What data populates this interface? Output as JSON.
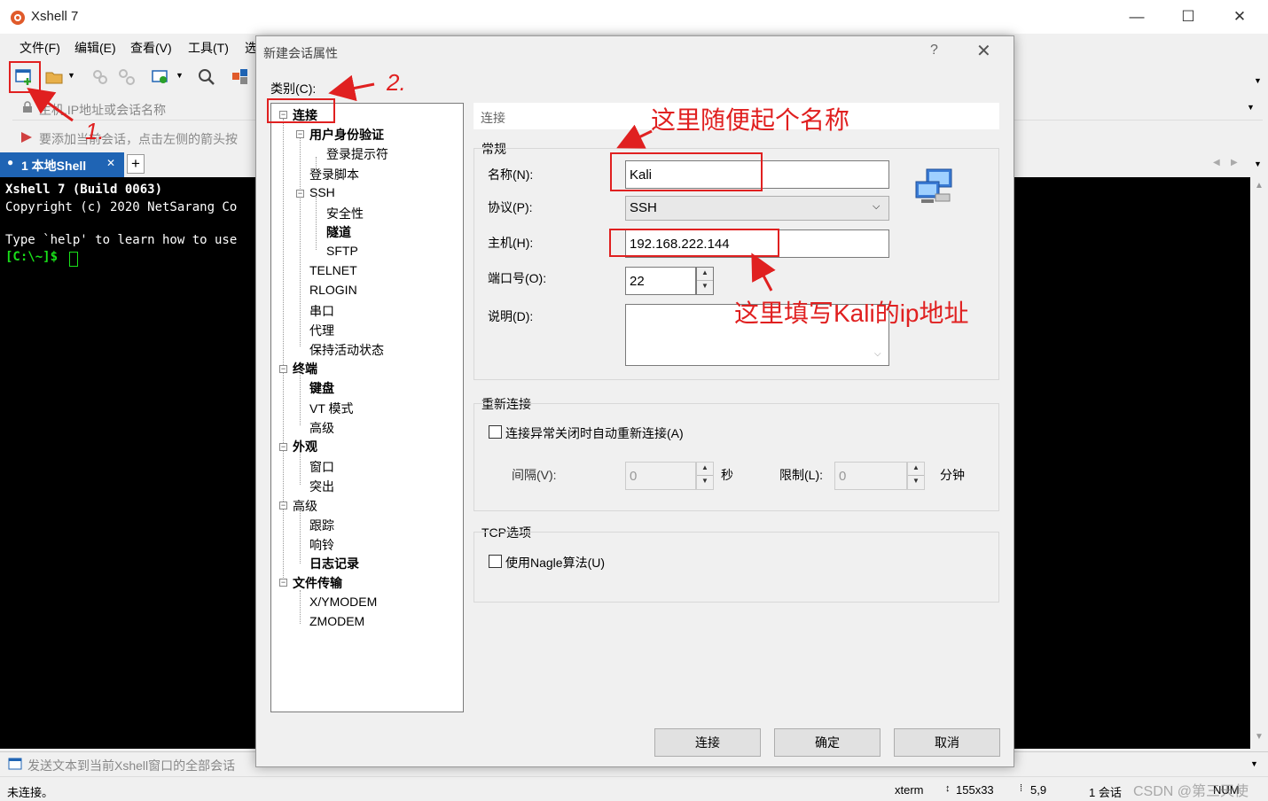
{
  "app": {
    "title": "Xshell 7",
    "window_controls": {
      "minimize": "—",
      "maximize": "☐",
      "close": "✕"
    }
  },
  "menu": [
    "文件(F)",
    "编辑(E)",
    "查看(V)",
    "工具(T)",
    "选"
  ],
  "address": {
    "placeholder": "主机,IP地址或会话名称"
  },
  "hint": {
    "text": "要添加当前会话，点击左侧的箭头按"
  },
  "tabs": {
    "active_label": "1 本地Shell",
    "close": "✕",
    "add": "+"
  },
  "terminal": {
    "lines": [
      "Xshell 7 (Build 0063)",
      "Copyright (c) 2020 NetSarang Co",
      "",
      "Type `help' to learn how to use"
    ],
    "prompt": "[C:\\~]$ "
  },
  "sendbar": {
    "text": "发送文本到当前Xshell窗口的全部会话"
  },
  "status": {
    "left": "未连接。",
    "term": "xterm",
    "size": "155x33",
    "pos": "5,9",
    "sessions": "1 会话",
    "num": "NUM",
    "watermark": "CSDN @第三天使"
  },
  "dialog": {
    "title": "新建会话属性",
    "help": "?",
    "close": "✕",
    "category_label": "类别(C):",
    "tree": [
      {
        "label": "连接",
        "bold": true
      },
      {
        "label": "用户身份验证",
        "bold": true
      },
      {
        "label": "登录提示符",
        "bold": false
      },
      {
        "label": "登录脚本",
        "bold": false
      },
      {
        "label": "SSH",
        "bold": false
      },
      {
        "label": "安全性",
        "bold": false
      },
      {
        "label": "隧道",
        "bold": true
      },
      {
        "label": "SFTP",
        "bold": false
      },
      {
        "label": "TELNET",
        "bold": false
      },
      {
        "label": "RLOGIN",
        "bold": false
      },
      {
        "label": "串口",
        "bold": false
      },
      {
        "label": "代理",
        "bold": false
      },
      {
        "label": "保持活动状态",
        "bold": false
      },
      {
        "label": "终端",
        "bold": true
      },
      {
        "label": "键盘",
        "bold": true
      },
      {
        "label": "VT 模式",
        "bold": false
      },
      {
        "label": "高级",
        "bold": false
      },
      {
        "label": "外观",
        "bold": true
      },
      {
        "label": "窗口",
        "bold": false
      },
      {
        "label": "突出",
        "bold": false
      },
      {
        "label": "高级",
        "bold": false
      },
      {
        "label": "跟踪",
        "bold": false
      },
      {
        "label": "响铃",
        "bold": false
      },
      {
        "label": "日志记录",
        "bold": true
      },
      {
        "label": "文件传输",
        "bold": true
      },
      {
        "label": "X/YMODEM",
        "bold": false
      },
      {
        "label": "ZMODEM",
        "bold": false
      }
    ],
    "panel_title": "连接",
    "general": {
      "title": "常规",
      "name_label": "名称(N):",
      "name_value": "Kali",
      "protocol_label": "协议(P):",
      "protocol_value": "SSH",
      "host_label": "主机(H):",
      "host_value": "192.168.222.144",
      "port_label": "端口号(O):",
      "port_value": "22",
      "desc_label": "说明(D):",
      "desc_value": ""
    },
    "reconnect": {
      "title": "重新连接",
      "auto_label": "连接异常关闭时自动重新连接(A)",
      "interval_label": "间隔(V):",
      "interval_value": "0",
      "interval_unit": "秒",
      "limit_label": "限制(L):",
      "limit_value": "0",
      "limit_unit": "分钟"
    },
    "tcp": {
      "title": "TCP选项",
      "nagle_label": "使用Nagle算法(U)"
    },
    "buttons": {
      "connect": "连接",
      "ok": "确定",
      "cancel": "取消"
    }
  },
  "annotations": {
    "step1": "1.",
    "step2": "2.",
    "name_hint": "这里随便起个名称",
    "host_hint": "这里填写Kali的ip地址",
    "color": "#e02020"
  }
}
